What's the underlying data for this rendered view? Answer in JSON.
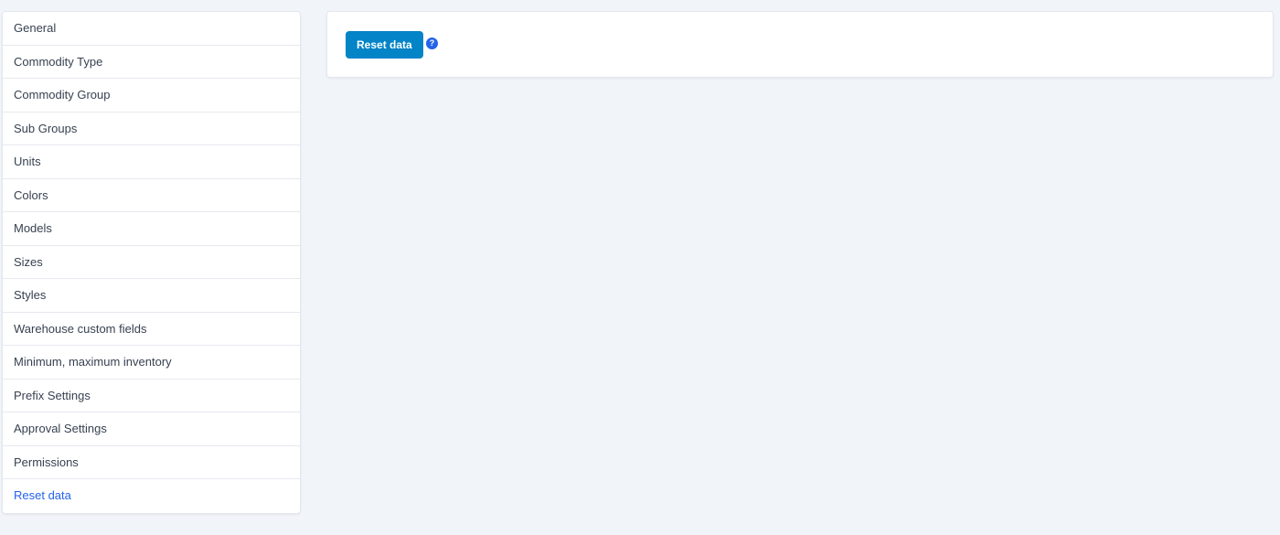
{
  "sidebar": {
    "items": [
      {
        "label": "General"
      },
      {
        "label": "Commodity Type"
      },
      {
        "label": "Commodity Group"
      },
      {
        "label": "Sub Groups"
      },
      {
        "label": "Units"
      },
      {
        "label": "Colors"
      },
      {
        "label": "Models"
      },
      {
        "label": "Sizes"
      },
      {
        "label": "Styles"
      },
      {
        "label": "Warehouse custom fields"
      },
      {
        "label": "Minimum, maximum inventory"
      },
      {
        "label": "Prefix Settings"
      },
      {
        "label": "Approval Settings"
      },
      {
        "label": "Permissions"
      },
      {
        "label": "Reset data",
        "active": true
      }
    ]
  },
  "main": {
    "reset_button_label": "Reset data",
    "help_icon": "question-circle-icon",
    "help_glyph": "?"
  },
  "colors": {
    "accent": "#0284c7",
    "active_link": "#2563eb",
    "background": "#f1f4f8"
  }
}
